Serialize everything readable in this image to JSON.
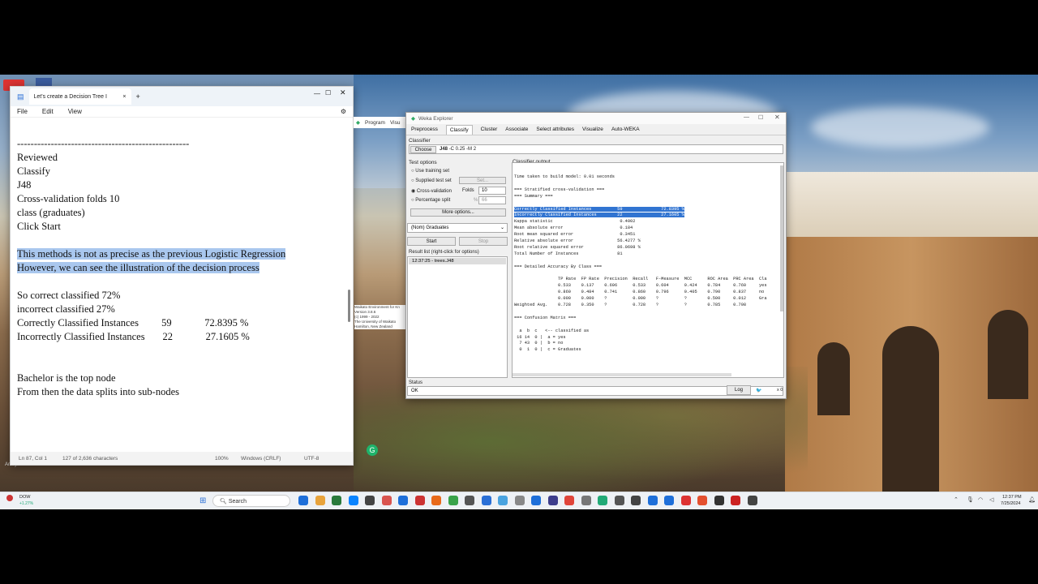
{
  "notepad": {
    "tab_title": "Let's create a Decision Tree I",
    "menu": [
      "File",
      "Edit",
      "View"
    ],
    "lines": [
      {
        "text": "---------------------------------------------------",
        "hl": false
      },
      {
        "text": "Reviewed",
        "hl": false
      },
      {
        "text": "Classify",
        "hl": false
      },
      {
        "text": "J48",
        "hl": false
      },
      {
        "text": "Cross-validation folds 10",
        "hl": false
      },
      {
        "text": "class (graduates)",
        "hl": false
      },
      {
        "text": "Click Start",
        "hl": false
      },
      {
        "text": "",
        "hl": false
      },
      {
        "text": "This methods is not as precise as the previous Logistic Regression",
        "hl": true
      },
      {
        "text": "However, we can see the illustration of the decision process",
        "hl": true
      },
      {
        "text": "",
        "hl": false
      },
      {
        "text": "So correct classified 72%",
        "hl": false
      },
      {
        "text": "incorrect classified 27%",
        "hl": false
      },
      {
        "text": "Correctly Classified Instances         59             72.8395 %",
        "hl": false
      },
      {
        "text": "Incorrectly Classified Instances       22             27.1605 %",
        "hl": false
      },
      {
        "text": "",
        "hl": false
      },
      {
        "text": "",
        "hl": false
      },
      {
        "text": "Bachelor is the top node",
        "hl": false
      },
      {
        "text": "From then the data splits into sub-nodes",
        "hl": false
      }
    ],
    "status": {
      "position": "Ln 87, Col 1",
      "chars": "127 of 2,636 characters",
      "zoom": "100%",
      "eol": "Windows (CRLF)",
      "encoding": "UTF-8"
    }
  },
  "bg_window": {
    "menu": [
      "Program",
      "Visu"
    ],
    "about_lines": [
      "Waikato Environment for Kn",
      "Version 3.8.6",
      "(c) 1999 - 2022",
      "The University of Waikato",
      "Hamilton, New Zealand"
    ]
  },
  "weka": {
    "title": "Weka Explorer",
    "tabs": [
      "Preprocess",
      "Classify",
      "Cluster",
      "Associate",
      "Select attributes",
      "Visualize",
      "Auto-WEKA"
    ],
    "active_tab": "Classify",
    "classifier_label": "Classifier",
    "choose_label": "Choose",
    "classifier_name": "J48",
    "classifier_params": "-C 0.25 -M 2",
    "test_options_label": "Test options",
    "opt_training": "Use training set",
    "opt_supplied": "Supplied test set",
    "set_label": "Set...",
    "opt_cv": "Cross-validation",
    "folds_label": "Folds",
    "folds_value": "10",
    "opt_split": "Percentage split",
    "pct_label": "%",
    "pct_value": "66",
    "more_options": "More options...",
    "class_select": "(Nom) Graduates",
    "start_label": "Start",
    "stop_label": "Stop",
    "result_list_label": "Result list (right-click for options)",
    "result_item": "12:37:25 - trees.J48",
    "output_label": "Classifier output",
    "output_lines": [
      "Time taken to build model: 0.01 seconds",
      "",
      "=== Stratified cross-validation ===",
      "=== Summary ===",
      "",
      "Correctly Classified Instances          59               72.8395 %",
      "Incorrectly Classified Instances        22               27.1605 %",
      "Kappa statistic                          0.4002",
      "Mean absolute error                      0.184",
      "Root mean squared error                  0.3451",
      "Relative absolute error                 56.4277 %",
      "Root relative squared error             86.0698 %",
      "Total Number of Instances               81",
      "",
      "=== Detailed Accuracy By Class ===",
      "",
      "                 TP Rate  FP Rate  Precision  Recall   F-Measure  MCC      ROC Area  PRC Area  Cla",
      "                 0.533    0.137    0.696      0.533    0.604      0.424    0.784     0.760     yes",
      "                 0.860    0.484    0.741      0.860    0.796      0.405    0.790     0.837     no",
      "                 0.000    0.000    ?          0.000    ?          ?        0.500     0.012     Gra",
      "Weighted Avg.    0.728    0.350    ?          0.728    ?          ?        0.785     0.798",
      "",
      "=== Confusion Matrix ===",
      "",
      "  a  b  c   <-- classified as",
      " 16 14  0 |  a = yes",
      "  7 43  0 |  b = no",
      "  0  1  0 |  c = Graduates"
    ],
    "status_label": "Status",
    "status_value": "OK",
    "log_label": "Log",
    "x_count": "x 0"
  },
  "taskbar": {
    "stock_name": "DOW",
    "stock_change": "+1.27%",
    "search_placeholder": "Search",
    "time": "12:37 PM",
    "date": "7/25/2024",
    "desktop_label": "Analyt"
  }
}
